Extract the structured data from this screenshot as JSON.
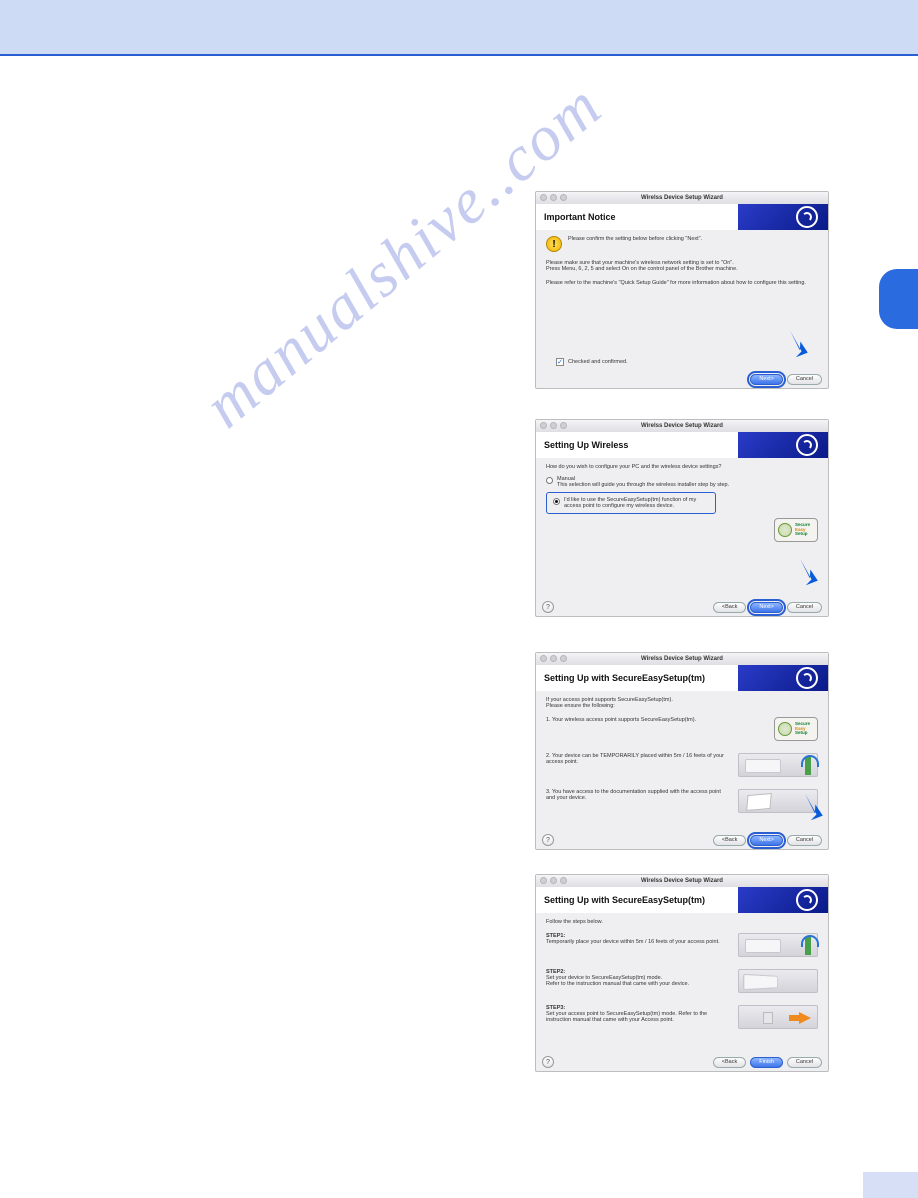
{
  "watermark": "manualshive..com",
  "wizard_title": "Wirelss Device Setup Wizard",
  "buttons": {
    "next": "Next>",
    "cancel": "Cancel",
    "back": "<Back",
    "finish": "Finish"
  },
  "ses_badge": {
    "l1": "Secure",
    "l2": "Easy",
    "l3": "Setup"
  },
  "w1": {
    "heading": "Important Notice",
    "line1": "Please confirm the setting below before clicking \"Next\".",
    "line2": "Please make sure that your machine's wireless network setting is set to \"On\".\nPress Menu, 6, 2, 5 and select On on the control panel of the Brother machine.",
    "line3": "Please refer to the machine's \"Quick Setup Guide\" for more information about how to configure this setting.",
    "check": "Checked and confirmed."
  },
  "w2": {
    "heading": "Setting Up Wireless",
    "question": "How do you wish to configure your PC and the wireless device settings?",
    "opt1_title": "Manual",
    "opt1_sub": "This selection will guide you through the wireless installer step by step.",
    "opt2": "I'd like to use the SecureEasySetup(tm) function of my access point to configure my wireless device."
  },
  "w3": {
    "heading": "Setting Up with SecureEasySetup(tm)",
    "intro": "If your access point supports SecureEasySetup(tm).\nPlease ensure the following:",
    "i1": "1. Your wireless access point supports SecureEasySetup(tm).",
    "i2": "2. Your device can be TEMPORARILY placed within 5m / 16 feets of your access point.",
    "i3": "3. You have access to the documentation supplied with the access point and your device."
  },
  "w4": {
    "heading": "Setting Up with SecureEasySetup(tm)",
    "intro": "Follow the steps below.",
    "s1_label": "STEP1:",
    "s1": "Temporarily place your device within 5m / 16 feets of your access point.",
    "s2_label": "STEP2:",
    "s2": "Set your device to SecureEasySetup(tm) mode.\nRefer to the instruction manual that came with your device.",
    "s3_label": "STEP3:",
    "s3": "Set your access point to SecureEasySetup(tm) mode. Refer to the instruction manual that came with your Access point."
  }
}
